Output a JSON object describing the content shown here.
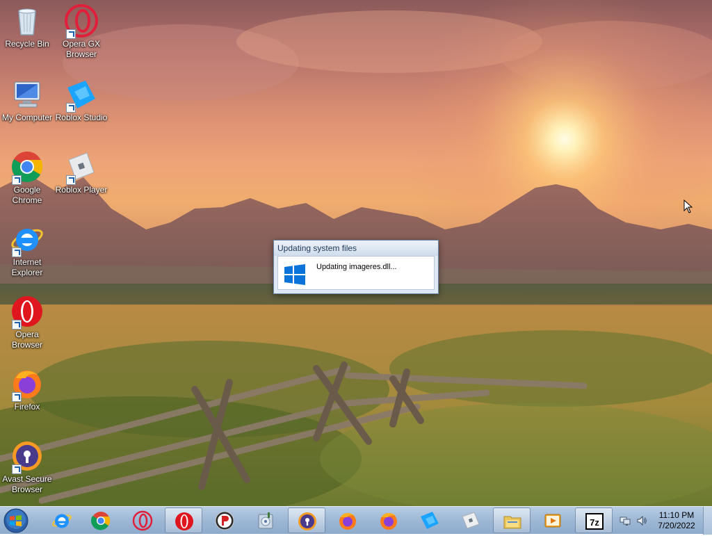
{
  "desktop": {
    "icons": [
      {
        "label": "Recycle Bin",
        "icon": "recycle-bin-icon"
      },
      {
        "label": "Opera GX Browser",
        "icon": "opera-gx-icon"
      },
      {
        "label": "My Computer",
        "icon": "my-computer-icon"
      },
      {
        "label": "Roblox Studio",
        "icon": "roblox-studio-icon"
      },
      {
        "label": "Google Chrome",
        "icon": "chrome-icon"
      },
      {
        "label": "Roblox Player",
        "icon": "roblox-player-icon"
      },
      {
        "label": "Internet Explorer",
        "icon": "internet-explorer-icon"
      },
      {
        "label": "Opera Browser",
        "icon": "opera-icon"
      },
      {
        "label": "Firefox",
        "icon": "firefox-icon"
      },
      {
        "label": "Avast Secure Browser",
        "icon": "avast-browser-icon"
      }
    ]
  },
  "dialog": {
    "title": "Updating system files",
    "message": "Updating imageres.dll..."
  },
  "taskbar": {
    "items": [
      "internet-explorer-icon",
      "chrome-icon",
      "opera-gx-icon",
      "opera-icon",
      "p-app-icon",
      "disk-utility-icon",
      "avast-browser-icon",
      "firefox-icon",
      "firefox-icon",
      "roblox-studio-icon",
      "roblox-player-icon",
      "file-explorer-icon",
      "media-player-icon",
      "7zip-icon"
    ],
    "seven_zip_label": "7z"
  },
  "tray": {
    "time": "11:10 PM",
    "date": "7/20/2022"
  },
  "colors": {
    "taskbar": "#9fb9d6",
    "dialog_frame": "#dfe9f5",
    "windows_blue": "#0a74da"
  }
}
